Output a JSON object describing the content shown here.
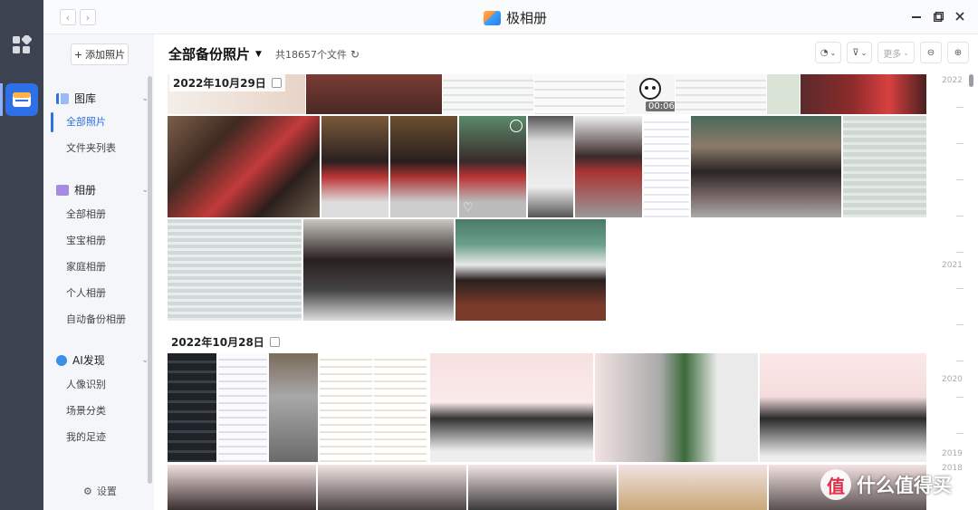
{
  "window": {
    "title": "极相册",
    "nav_back": "‹",
    "nav_forward": "›"
  },
  "sidebar": {
    "add_button": "添加照片",
    "sections": [
      {
        "label": "图库",
        "items": [
          "全部照片",
          "文件夹列表"
        ]
      },
      {
        "label": "相册",
        "items": [
          "全部相册",
          "宝宝相册",
          "家庭相册",
          "个人相册",
          "自动备份相册"
        ]
      },
      {
        "label": "AI发现",
        "items": [
          "人像识别",
          "场景分类",
          "我的足迹"
        ]
      }
    ],
    "active_item": "全部照片",
    "settings_label": "设置"
  },
  "main": {
    "title": "全部备份照片",
    "count_text": "共18657个文件",
    "toolbar": {
      "more_label": "更多"
    },
    "groups": [
      {
        "date": "2022年10月29日"
      },
      {
        "date": "2022年10月28日"
      }
    ],
    "video_duration": "00:06"
  },
  "timeline": {
    "years": [
      "2022",
      "2021",
      "2020",
      "2019",
      "2018"
    ]
  },
  "watermark": {
    "text": "什么值得买",
    "logo_char": "值"
  },
  "colors": {
    "accent": "#2f6fe8",
    "rail": "#3c4250"
  }
}
